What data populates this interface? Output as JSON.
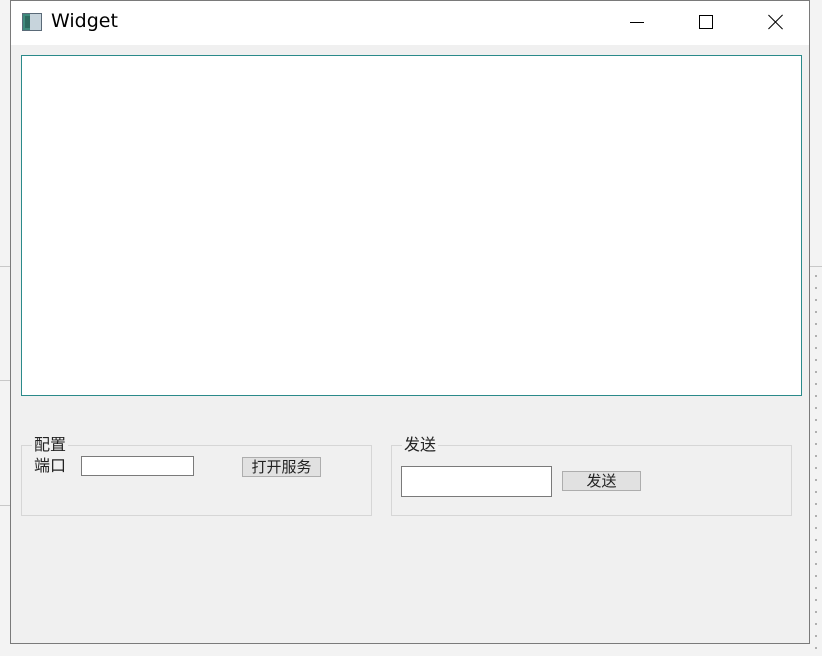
{
  "window": {
    "title": "Widget",
    "icons": {
      "app": "app-window-icon",
      "minimize": "minimize-icon",
      "maximize": "maximize-icon",
      "close": "close-icon"
    }
  },
  "output": {
    "text": ""
  },
  "config_group": {
    "title": "配置",
    "port_label": "端口",
    "port_value": "",
    "open_button": "打开服务"
  },
  "send_group": {
    "title": "发送",
    "message_value": "",
    "send_button": "发送"
  },
  "colors": {
    "window_bg": "#f0f0f0",
    "titlebar_bg": "#ffffff",
    "display_border": "#2a8a8a",
    "button_bg": "#e1e1e1"
  }
}
